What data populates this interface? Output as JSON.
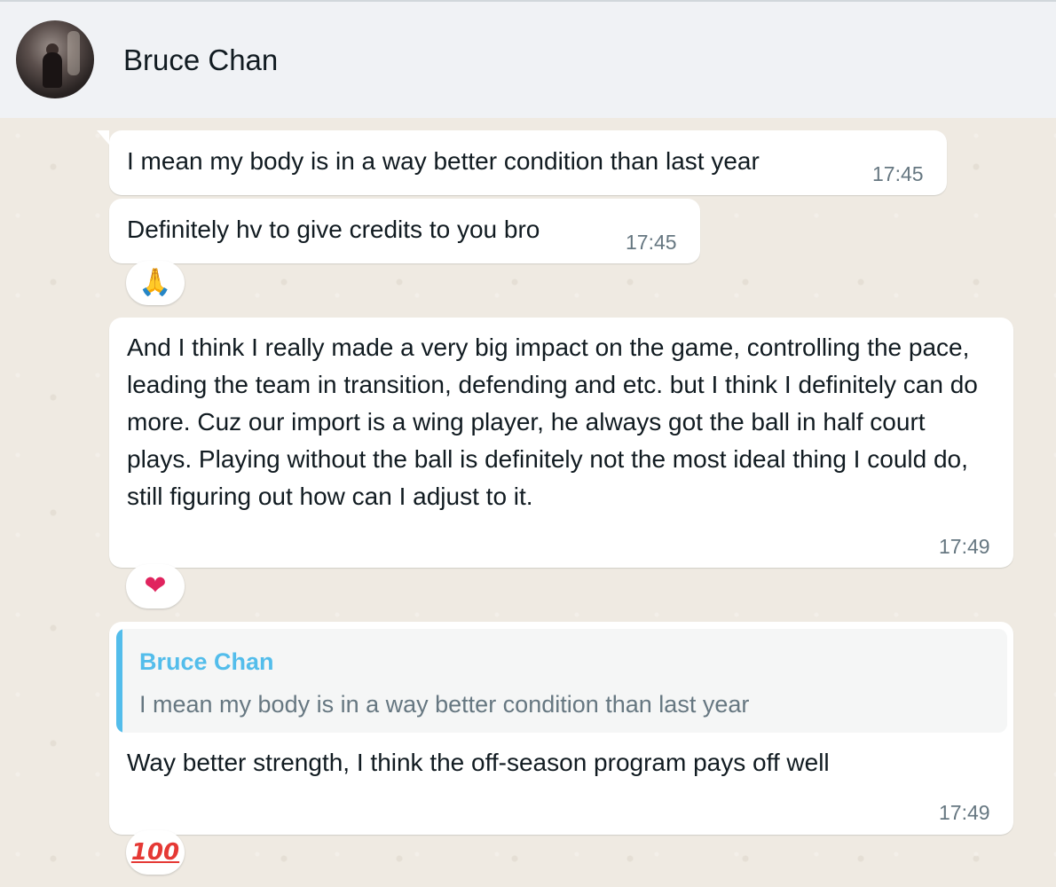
{
  "header": {
    "contact_name": "Bruce Chan"
  },
  "messages": [
    {
      "text": "I mean my body is in a way better condition than last year",
      "time": "17:45"
    },
    {
      "text": "Definitely hv to give credits to you bro",
      "time": "17:45",
      "reaction": {
        "icon": "folded-hands-icon",
        "glyph": "🙏"
      }
    },
    {
      "text": "And I think I really made a very big impact on the game, controlling the pace, leading the team in transition, defending and etc. but I think I definitely can do more. Cuz our import is a wing player, he always got the ball in half court plays. Playing without the ball is definitely not the most ideal thing I could do, still figuring out how can I adjust to it.",
      "time": "17:49",
      "reaction": {
        "icon": "red-heart-icon",
        "glyph": "❤"
      }
    },
    {
      "quote": {
        "name": "Bruce Chan",
        "text": "I mean my body is in a way better condition than last year"
      },
      "text": "Way better strength, I think the off-season program pays off well",
      "time": "17:49",
      "reaction": {
        "icon": "hundred-points-icon",
        "glyph": "100"
      }
    }
  ],
  "colors": {
    "chat_background": "#efeae2",
    "header_background": "#f0f2f5",
    "bubble": "#ffffff",
    "quote_accent": "#53bdeb",
    "timestamp": "#667781"
  }
}
